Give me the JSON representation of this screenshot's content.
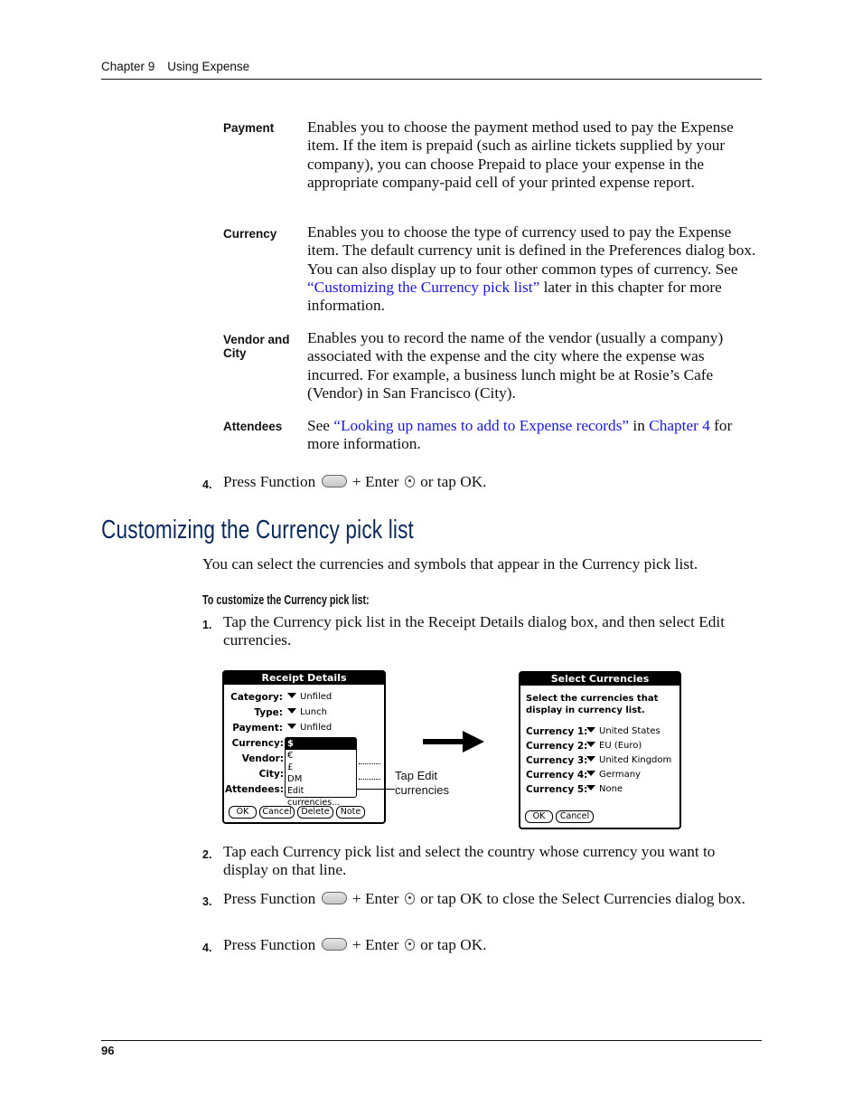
{
  "header": {
    "chapter": "Chapter 9",
    "title": "Using Expense"
  },
  "definitions": [
    {
      "term": "Payment",
      "description": "Enables you to choose the payment method used to pay the Expense item. If the item is prepaid (such as airline tickets supplied by your company), you can choose Prepaid to place your expense in the appropriate company-paid cell of your printed expense report."
    },
    {
      "term": "Currency",
      "description_before": "Enables you to choose the type of currency used to pay the Expense item. The default currency unit is defined in the Preferences dialog box. You can also display up to four other common types of currency. See ",
      "link": "“Customizing the Currency pick list”",
      "description_after": " later in this chapter for more information."
    },
    {
      "term": "Vendor and City",
      "description": "Enables you to record the name of the vendor (usually a company) associated with the expense and the city where the expense was incurred. For example, a business lunch might be at Rosie’s Cafe (Vendor) in San Francisco (City)."
    },
    {
      "term": "Attendees",
      "before": "See ",
      "link1": "“Looking up names to add to Expense records”",
      "middle": " in ",
      "link2": "Chapter 4",
      "after": " for more information."
    }
  ],
  "step_top": {
    "number": "4.",
    "pre": "Press Function",
    "mid": "+ Enter",
    "post": "or tap OK."
  },
  "section": {
    "title": "Customizing the Currency pick list",
    "intro": "You can select the currencies and symbols that appear in the Currency pick list.",
    "subhead": "To customize the Currency pick list:",
    "steps": [
      {
        "number": "1.",
        "text": "Tap the Currency pick list in the Receipt Details dialog box, and then select Edit currencies."
      },
      {
        "number": "2.",
        "text": "Tap each Currency pick list and select the country whose currency you want to display on that line."
      },
      {
        "number": "3.",
        "pre": "Press Function",
        "mid": "+ Enter",
        "post": "or tap OK to close the Select Currencies dialog box."
      },
      {
        "number": "4.",
        "pre": "Press Function",
        "mid": "+ Enter",
        "post": "or tap OK."
      }
    ]
  },
  "receipt_dialog": {
    "title": "Receipt Details",
    "fields": [
      {
        "label": "Category:",
        "value": "Unfiled"
      },
      {
        "label": "Type:",
        "value": "Lunch"
      },
      {
        "label": "Payment:",
        "value": "Unfiled"
      },
      {
        "label": "Currency:"
      },
      {
        "label": "Vendor:"
      },
      {
        "label": "City:"
      },
      {
        "label": "Attendees:"
      }
    ],
    "currency_options": [
      "$",
      "€",
      "£",
      "DM",
      "Edit currencies..."
    ],
    "selected_option": "$",
    "buttons": [
      "OK",
      "Cancel",
      "Delete",
      "Note"
    ]
  },
  "callout": {
    "line1": "Tap Edit",
    "line2": "currencies"
  },
  "select_dialog": {
    "title": "Select Currencies",
    "instruction_line1": "Select the currencies that",
    "instruction_line2": "display in currency list.",
    "rows": [
      {
        "label": "Currency 1:",
        "value": "United States"
      },
      {
        "label": "Currency 2:",
        "value": "EU (Euro)"
      },
      {
        "label": "Currency 3:",
        "value": "United Kingdom"
      },
      {
        "label": "Currency 4:",
        "value": "Germany"
      },
      {
        "label": "Currency 5:",
        "value": "None"
      }
    ],
    "buttons": [
      "OK",
      "Cancel"
    ]
  },
  "footer": {
    "page_number": "96"
  },
  "colors": {
    "link": "#1a1adc",
    "heading": "#0d2a5c"
  }
}
